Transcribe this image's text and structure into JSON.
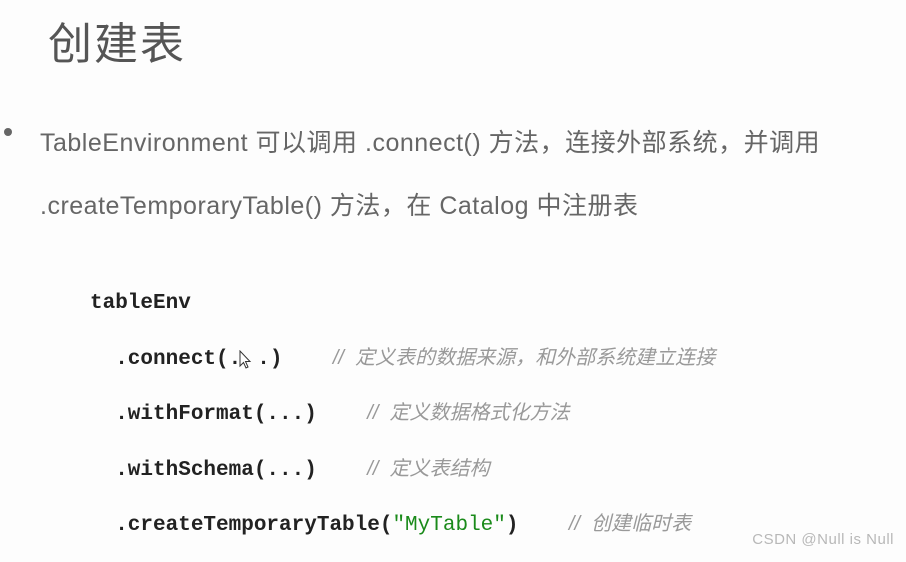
{
  "title": "创建表",
  "description": "TableEnvironment 可以调用 .connect() 方法，连接外部系统，并调用 .createTemporaryTable() 方法，在 Catalog 中注册表",
  "code": {
    "line1": "tableEnv",
    "line2_method": "  .connect(. .)",
    "line2_comment": "//  定义表的数据来源，和外部系统建立连接",
    "line3_method": "  .withFormat(...)",
    "line3_comment": "//  定义数据格式化方法",
    "line4_method": "  .withSchema(...)",
    "line4_comment": "//  定义表结构",
    "line5_prefix": "  .createTemporaryTable(",
    "line5_str": "\"MyTable\"",
    "line5_suffix": ")",
    "line5_comment": "//  创建临时表"
  },
  "watermark": "CSDN @Null is Null"
}
